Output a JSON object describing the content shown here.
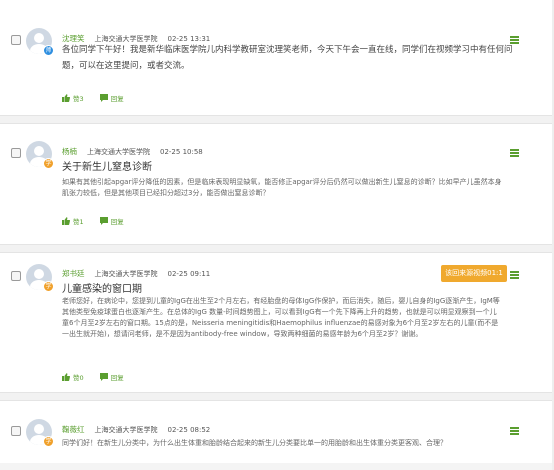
{
  "posts": [
    {
      "username": "沈理笑",
      "school": "上海交通大学医学院",
      "time": "02-25 13:31",
      "badge": "师",
      "title": "",
      "body": "各位同学下午好！我是新华临床医学院儿内科学教研室沈理笑老师，今天下午会一直在线，同学们在视频学习中有任何问题，可以在这里提问，或者交流。",
      "like_label": "赞3",
      "reply_label": "回复"
    },
    {
      "username": "杨楠",
      "school": "上海交通大学医学院",
      "time": "02-25 10:58",
      "badge": "学",
      "title": "关于新生儿窒息诊断",
      "body": "如果有其他引起apgar评分降低的因素，但是临床表现明显缺氧，能否修正apgar评分后仍然可以做出新生儿窒息的诊断？比如早产儿虽然本身肌张力较低，但是其他项目已经扣分超过3分，能否做出窒息诊断？",
      "like_label": "赞1",
      "reply_label": "回复"
    },
    {
      "username": "郑书廷",
      "school": "上海交通大学医学院",
      "time": "02-25 09:11",
      "badge": "学",
      "title": "儿童感染的窗口期",
      "body": "老师您好，在病论中，您提到儿童的IgG在出生至2个月左右，有经胎盘的母体IgG作保护，而后消失，随后，婴儿自身的IgG逐渐产生，IgM等其他类型免疫球蛋白也逐渐产生。在总体的IgG 数量-时间趋势图上，可以看到IgG有一个先下降再上升的趋势，也就是可以明显观察到一个儿童6个月至2岁左右的窗口期。15点的是，Neisseria meningitidis和Haemophilus influenzae的易感对象为6个月至2岁左右的儿童(而不是一出生就开始)，想请问老师，是不是因为antibody-free window，导致两种细菌的易感年龄为6个月至2岁？谢谢。",
      "tag_label": "该回来源视频01:1",
      "like_label": "赞0",
      "reply_label": "回复"
    },
    {
      "username": "鞠薇红",
      "school": "上海交通大学医学院",
      "time": "02-25 08:52",
      "badge": "学",
      "title": "",
      "body": "同学们好！在新生儿分类中，为什么出生体重和胎龄结合起来的新生儿分类要比单一的用胎龄和出生体重分类更客观、合理？",
      "like_label": "",
      "reply_label": ""
    }
  ],
  "colors": {
    "accent_green": "#5a9e2f",
    "tag_orange": "#f0a92e",
    "badge_blue": "#2f8fe0",
    "badge_orange": "#f0a02a"
  }
}
